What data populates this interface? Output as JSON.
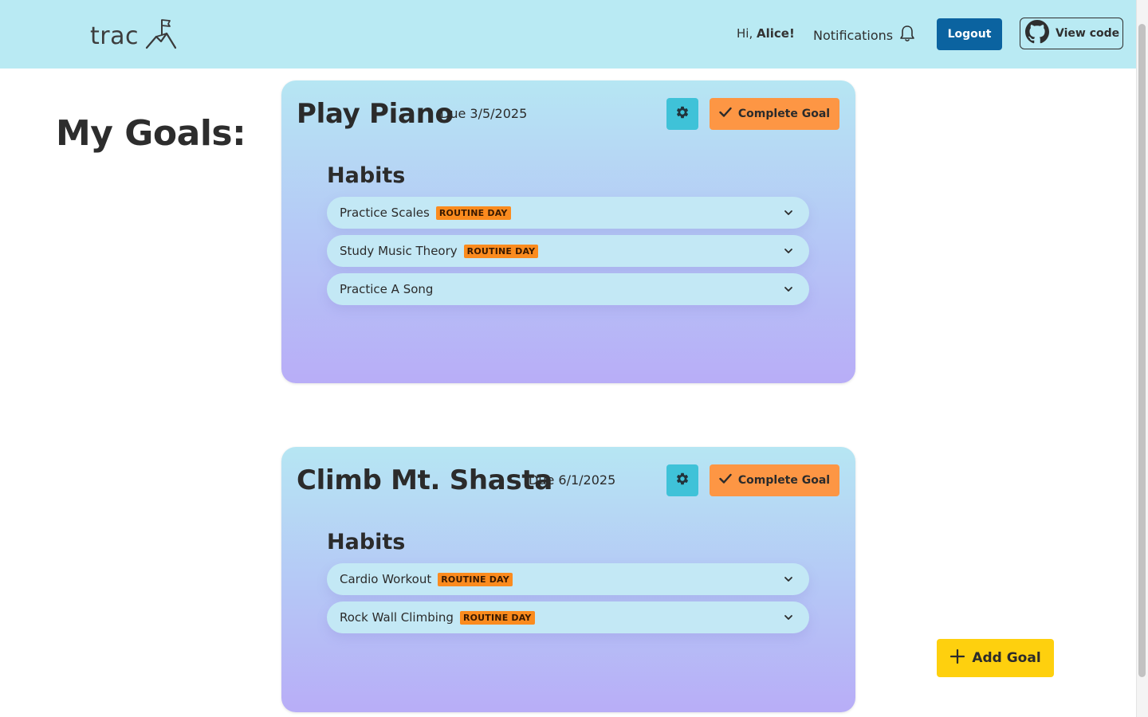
{
  "header": {
    "logo_text": "trac",
    "greeting_prefix": "Hi,",
    "user_name": "Alice!",
    "notifications_label": "Notifications",
    "logout_label": "Logout",
    "view_code_label": "View code",
    "background_color": "#b9eaf3"
  },
  "page": {
    "title": "My Goals:"
  },
  "goals": [
    {
      "title": "Play Piano",
      "due": "Due 3/5/2025",
      "complete_label": "Complete Goal",
      "habits_heading": "Habits",
      "habits": [
        {
          "name": "Practice Scales",
          "badge": "ROUTINE DAY"
        },
        {
          "name": "Study Music Theory",
          "badge": "ROUTINE DAY"
        },
        {
          "name": "Practice A Song",
          "badge": ""
        }
      ]
    },
    {
      "title": "Climb Mt. Shasta",
      "due": "Due 6/1/2025",
      "complete_label": "Complete Goal",
      "habits_heading": "Habits",
      "habits": [
        {
          "name": "Cardio Workout",
          "badge": "ROUTINE DAY"
        },
        {
          "name": "Rock Wall Climbing",
          "badge": "ROUTINE DAY"
        }
      ]
    }
  ],
  "actions": {
    "add_goal_label": "Add Goal"
  },
  "colors": {
    "logout_button": "#0b63a0",
    "gear_button": "#3fc2d8",
    "complete_button": "#fd9644",
    "routine_badge": "#fb8b1e",
    "add_goal_button": "#fed00e"
  },
  "icons": {
    "logo": "mountain-flag-icon",
    "notifications": "bell-icon",
    "view_code": "github-icon",
    "settings": "gear-icon",
    "complete": "check-icon",
    "expand": "chevron-down-icon",
    "add": "plus-icon"
  }
}
